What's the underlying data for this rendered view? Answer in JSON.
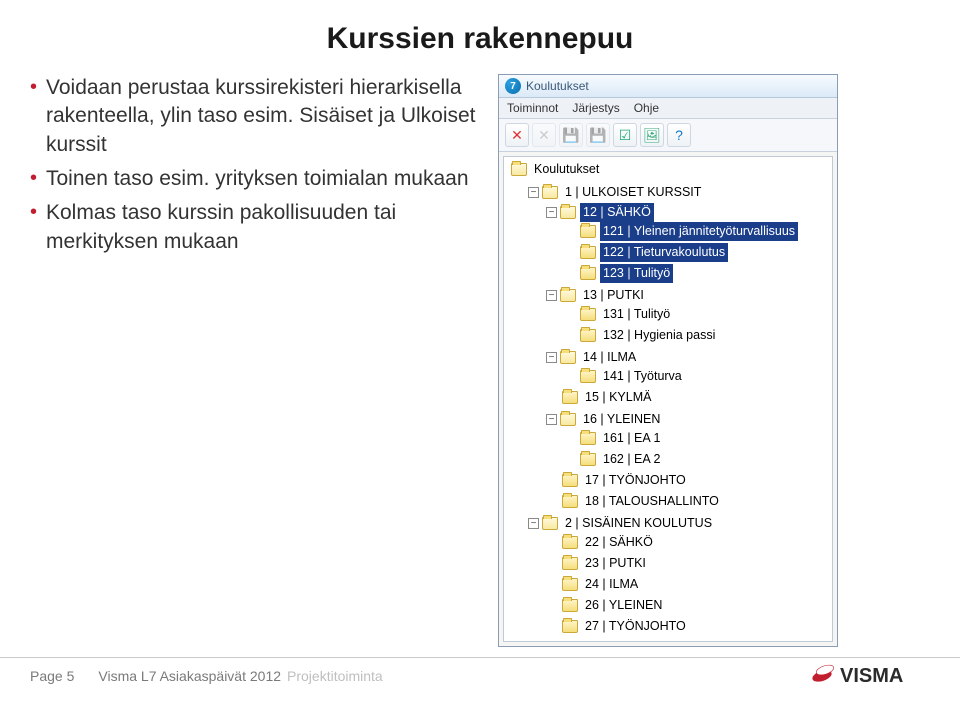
{
  "slide": {
    "title": "Kurssien rakennepuu",
    "bullets": [
      "Voidaan perustaa kurssirekisteri hierarkisella rakenteella, ylin taso esim. Sisäiset ja Ulkoiset kurssit",
      "Toinen taso esim. yrityksen toimialan mukaan",
      "Kolmas taso kurssin pakollisuuden tai merkityksen mukaan"
    ]
  },
  "app": {
    "title": "Koulutukset",
    "menus": [
      "Toiminnot",
      "Järjestys",
      "Ohje"
    ],
    "toolbar": [
      {
        "name": "new-icon",
        "glyph": "✕",
        "color": "#d33",
        "disabled": false
      },
      {
        "name": "delete-icon",
        "glyph": "✕",
        "color": "#999",
        "disabled": true
      },
      {
        "name": "save-icon",
        "glyph": "💾",
        "color": "#555",
        "disabled": true
      },
      {
        "name": "save-copy-icon",
        "glyph": "💾",
        "color": "#555",
        "disabled": true
      },
      {
        "name": "options-icon",
        "glyph": "☑",
        "color": "#2a7",
        "disabled": false
      },
      {
        "name": "image-icon",
        "glyph": "🖼",
        "color": "#3a7",
        "disabled": false
      },
      {
        "name": "help-icon",
        "glyph": "?",
        "color": "#1577c4",
        "disabled": false
      }
    ],
    "tree": {
      "root": "Koulutukset",
      "nodes": [
        {
          "label": "1 | ULKOISET KURSSIT",
          "open": true,
          "children": [
            {
              "label": "12 | SÄHKÖ",
              "open": true,
              "selected": true,
              "children": [
                {
                  "label": "121 | Yleinen jännitetyöturvallisuus"
                },
                {
                  "label": "122 | Tieturvakoulutus"
                },
                {
                  "label": "123 | Tulityö"
                }
              ]
            },
            {
              "label": "13 | PUTKI",
              "open": true,
              "children": [
                {
                  "label": "131 | Tulityö"
                },
                {
                  "label": "132 | Hygienia passi"
                }
              ]
            },
            {
              "label": "14 | ILMA",
              "open": true,
              "children": [
                {
                  "label": "141 | Työturva"
                }
              ]
            },
            {
              "label": "15 | KYLMÄ"
            },
            {
              "label": "16 | YLEINEN",
              "open": true,
              "children": [
                {
                  "label": "161 | EA 1"
                },
                {
                  "label": "162 | EA 2"
                }
              ]
            },
            {
              "label": "17 | TYÖNJOHTO"
            },
            {
              "label": "18 | TALOUSHALLINTO"
            }
          ]
        },
        {
          "label": "2 | SISÄINEN KOULUTUS",
          "open": true,
          "children": [
            {
              "label": "22 | SÄHKÖ"
            },
            {
              "label": "23 | PUTKI"
            },
            {
              "label": "24 | ILMA"
            },
            {
              "label": "26 | YLEINEN"
            },
            {
              "label": "27 | TYÖNJOHTO"
            }
          ]
        }
      ]
    }
  },
  "footer": {
    "page": "Page 5",
    "event": "Visma L7 Asiakaspäivät 2012",
    "project": "Projektitoiminta",
    "logo_text": "VISMA"
  }
}
